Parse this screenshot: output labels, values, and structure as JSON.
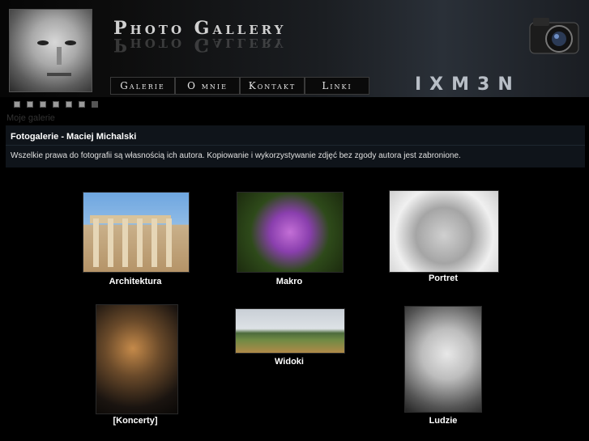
{
  "header": {
    "title": "Photo Gallery",
    "title_reflection": "Photo Gallery",
    "brand": "IXM3N"
  },
  "nav": {
    "items": [
      {
        "label": "Galerie"
      },
      {
        "label": "O mnie"
      },
      {
        "label": "Kontakt"
      },
      {
        "label": "Linki"
      }
    ]
  },
  "album_label": "Moje galerie",
  "info": {
    "title": "Fotogalerie - Maciej Michalski",
    "text": "Wszelkie prawa do fotografii są własnością ich autora. Kopiowanie i wykorzystywanie zdjęć bez zgody autora jest zabronione."
  },
  "galleries": [
    {
      "caption": "Architektura"
    },
    {
      "caption": "Makro"
    },
    {
      "caption": "Portret"
    },
    {
      "caption": "[Koncerty]"
    },
    {
      "caption": "Widoki"
    },
    {
      "caption": "Ludzie"
    }
  ],
  "icons": {
    "camera": "camera-icon",
    "dots": "pagination-dots"
  },
  "colors": {
    "background": "#000000",
    "info_box": "#0f141a",
    "text": "#ffffff"
  }
}
